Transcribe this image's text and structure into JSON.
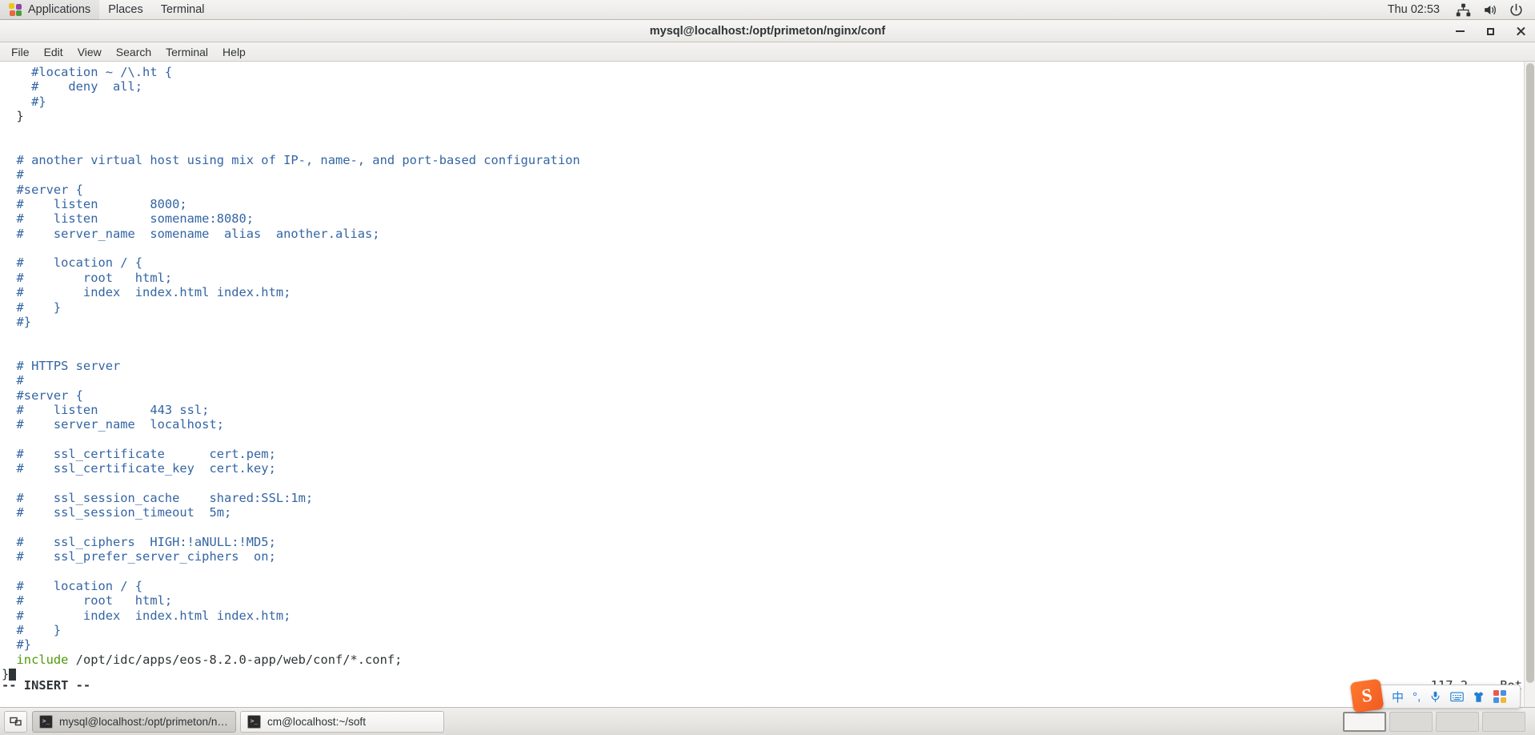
{
  "top_panel": {
    "menus": [
      {
        "label": "Applications",
        "icon": "applications-icon"
      },
      {
        "label": "Places",
        "icon": null
      },
      {
        "label": "Terminal",
        "icon": null
      }
    ],
    "clock": "Thu 02:53",
    "tray": [
      "network-icon",
      "volume-icon",
      "power-icon"
    ]
  },
  "window": {
    "title": "mysql@localhost:/opt/primeton/nginx/conf",
    "controls": {
      "minimize": "minimize-button",
      "maximize": "maximize-button",
      "close": "close-button"
    },
    "menu_bar": [
      "File",
      "Edit",
      "View",
      "Search",
      "Terminal",
      "Help"
    ]
  },
  "terminal": {
    "lines": [
      {
        "text": "    #location ~ /\\.ht {",
        "color": "comment"
      },
      {
        "text": "    #    deny  all;",
        "color": "comment"
      },
      {
        "text": "    #}",
        "color": "comment"
      },
      {
        "text": "  }",
        "color": "plain"
      },
      {
        "text": "",
        "color": "plain"
      },
      {
        "text": "",
        "color": "plain"
      },
      {
        "text": "  # another virtual host using mix of IP-, name-, and port-based configuration",
        "color": "comment"
      },
      {
        "text": "  #",
        "color": "comment"
      },
      {
        "text": "  #server {",
        "color": "comment"
      },
      {
        "text": "  #    listen       8000;",
        "color": "comment"
      },
      {
        "text": "  #    listen       somename:8080;",
        "color": "comment"
      },
      {
        "text": "  #    server_name  somename  alias  another.alias;",
        "color": "comment"
      },
      {
        "text": "",
        "color": "plain"
      },
      {
        "text": "  #    location / {",
        "color": "comment"
      },
      {
        "text": "  #        root   html;",
        "color": "comment"
      },
      {
        "text": "  #        index  index.html index.htm;",
        "color": "comment"
      },
      {
        "text": "  #    }",
        "color": "comment"
      },
      {
        "text": "  #}",
        "color": "comment"
      },
      {
        "text": "",
        "color": "plain"
      },
      {
        "text": "",
        "color": "plain"
      },
      {
        "text": "  # HTTPS server",
        "color": "comment"
      },
      {
        "text": "  #",
        "color": "comment"
      },
      {
        "text": "  #server {",
        "color": "comment"
      },
      {
        "text": "  #    listen       443 ssl;",
        "color": "comment"
      },
      {
        "text": "  #    server_name  localhost;",
        "color": "comment"
      },
      {
        "text": "",
        "color": "plain"
      },
      {
        "text": "  #    ssl_certificate      cert.pem;",
        "color": "comment"
      },
      {
        "text": "  #    ssl_certificate_key  cert.key;",
        "color": "comment"
      },
      {
        "text": "",
        "color": "plain"
      },
      {
        "text": "  #    ssl_session_cache    shared:SSL:1m;",
        "color": "comment"
      },
      {
        "text": "  #    ssl_session_timeout  5m;",
        "color": "comment"
      },
      {
        "text": "",
        "color": "plain"
      },
      {
        "text": "  #    ssl_ciphers  HIGH:!aNULL:!MD5;",
        "color": "comment"
      },
      {
        "text": "  #    ssl_prefer_server_ciphers  on;",
        "color": "comment"
      },
      {
        "text": "",
        "color": "plain"
      },
      {
        "text": "  #    location / {",
        "color": "comment"
      },
      {
        "text": "  #        root   html;",
        "color": "comment"
      },
      {
        "text": "  #        index  index.html index.htm;",
        "color": "comment"
      },
      {
        "text": "  #    }",
        "color": "comment"
      },
      {
        "text": "  #}",
        "color": "comment"
      }
    ],
    "include_line": {
      "keyword": "  include",
      "value": " /opt/idc/apps/eos-8.2.0-app/web/conf/*.conf;"
    },
    "last_line": "}",
    "status_mode": "-- INSERT --",
    "status_ruler": "117,2",
    "status_position": "Bot"
  },
  "ime": {
    "logo": "S",
    "items": [
      {
        "icon": "chinese-mode-icon",
        "label": "中"
      },
      {
        "icon": "punctuation-icon",
        "label": "°,"
      },
      {
        "icon": "microphone-icon",
        "label": ""
      },
      {
        "icon": "keyboard-icon",
        "label": ""
      },
      {
        "icon": "skin-icon",
        "label": ""
      },
      {
        "icon": "toolbox-icon",
        "label": ""
      }
    ]
  },
  "taskbar": {
    "show_desktop": "show-desktop-button",
    "tasks": [
      {
        "label": "mysql@localhost:/opt/primeton/ngi...",
        "icon": "terminal-icon",
        "active": true
      },
      {
        "label": "cm@localhost:~/soft",
        "icon": "terminal-icon",
        "active": false
      }
    ],
    "workspaces": [
      {
        "name": "workspace-1",
        "active": true
      },
      {
        "name": "workspace-2",
        "active": false
      },
      {
        "name": "workspace-3",
        "active": false
      },
      {
        "name": "workspace-4",
        "active": false
      }
    ]
  },
  "colors": {
    "comment_blue": "#3465a4",
    "keyword_green": "#4e9a06",
    "text_dark": "#2e3436",
    "ime_orange": "#f05a22"
  }
}
